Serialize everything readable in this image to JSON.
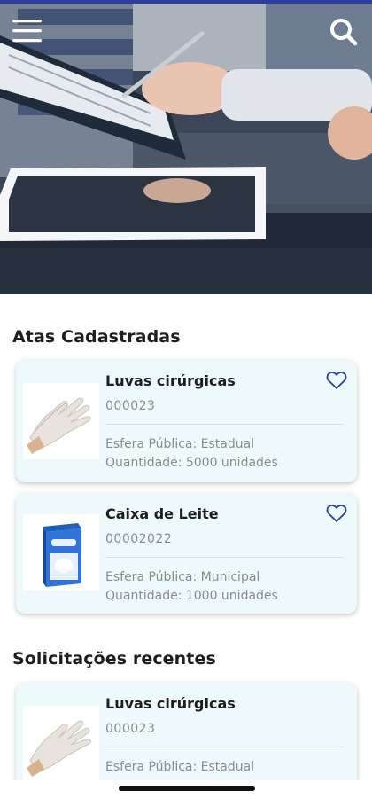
{
  "sections": {
    "atas_title": "Atas Cadastradas",
    "recent_title": "Solicitações recentes"
  },
  "atas": [
    {
      "name": "Luvas cirúrgicas",
      "code": "000023",
      "esfera": "Esfera Pública: Estadual",
      "quantidade": "Quantidade: 5000 unidades",
      "image": "surgical-gloves"
    },
    {
      "name": "Caixa de Leite",
      "code": "00002022",
      "esfera": "Esfera Pública: Municipal",
      "quantidade": "Quantidade: 1000 unidades",
      "image": "milk-carton"
    }
  ],
  "recentes": [
    {
      "name": "Luvas cirúrgicas",
      "code": "000023",
      "esfera": "Esfera Pública: Estadual",
      "image": "surgical-gloves"
    }
  ],
  "icons": {
    "menu": "hamburger-menu-icon",
    "search": "search-icon",
    "favorite": "heart-outline-icon"
  },
  "colors": {
    "accent": "#2b3f9e",
    "card_bg": "#eef9fc",
    "muted_text": "#8c8c8c"
  }
}
